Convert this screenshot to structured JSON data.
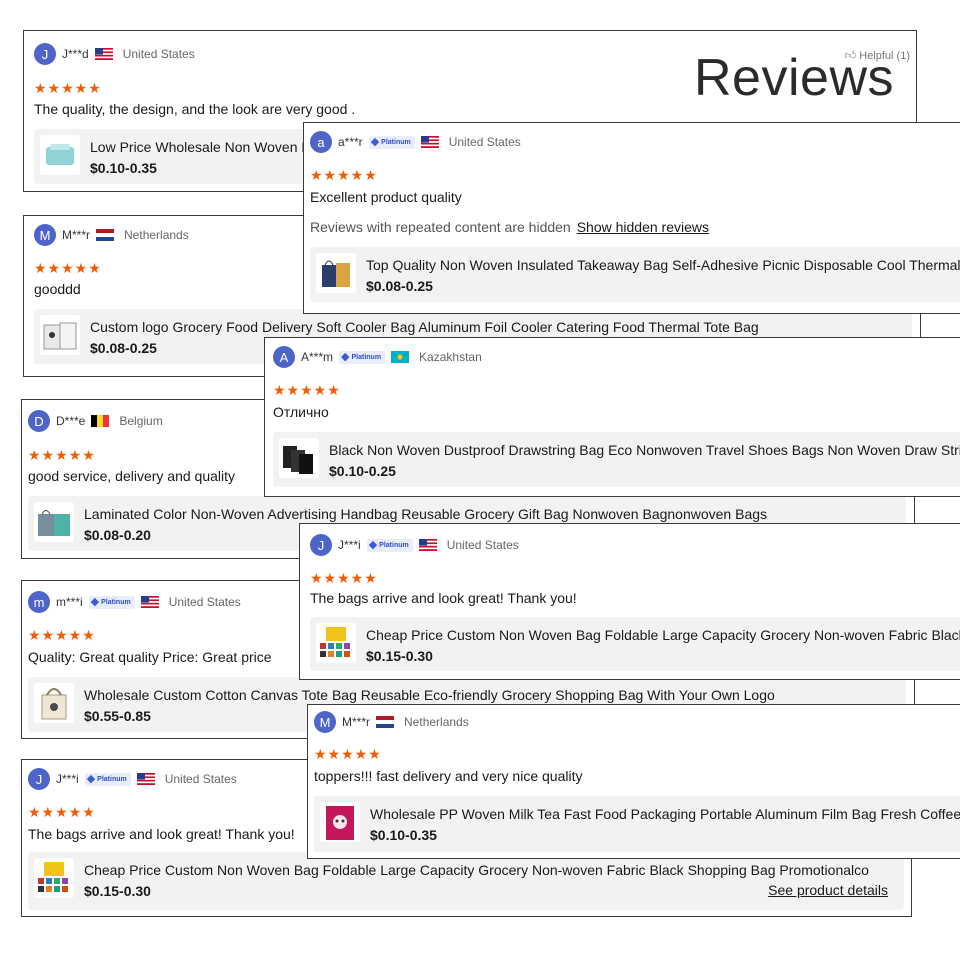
{
  "page_title": "Reviews",
  "helpful_label": "Helpful (1)",
  "hidden_note": "Reviews with repeated content are hidden",
  "show_hidden_label": "Show hidden reviews",
  "see_details_label": "See product details",
  "badge_label": "Platinum",
  "star_glyphs": "★★★★★",
  "colors": {
    "accent_star": "#f25c05",
    "avatar": "#4d64c9",
    "badge": "#2f4fc9"
  },
  "reviews": [
    {
      "initial": "J",
      "user": "J***d",
      "country": "United States",
      "text": "The quality, the design, and the look are very good .",
      "product": "Low Price Wholesale Non Woven Bag",
      "price": "$0.10-0.35"
    },
    {
      "initial": "a",
      "user": "a***r",
      "country": "United States",
      "text": "Excellent product quality",
      "product": "Top Quality Non Woven Insulated Takeaway Bag Self-Adhesive Picnic Disposable Cool Thermal Bag",
      "price": "$0.08-0.25"
    },
    {
      "initial": "M",
      "user": "M***r",
      "country": "Netherlands",
      "text": "gooddd",
      "product": "Custom logo Grocery Food Delivery Soft Cooler Bag Aluminum Foil Cooler Catering Food Thermal Tote Bag",
      "price": "$0.08-0.25"
    },
    {
      "initial": "A",
      "user": "A***m",
      "country": "Kazakhstan",
      "text": "Отлично",
      "product": "Black Non Woven Dustproof Drawstring Bag Eco Nonwoven Travel Shoes Bags Non Woven Draw String Bag",
      "price": "$0.10-0.25"
    },
    {
      "initial": "D",
      "user": "D***e",
      "country": "Belgium",
      "text": "good service, delivery and quality",
      "product": "Laminated Color Non-Woven Advertising Handbag Reusable Grocery Gift Bag Nonwoven Bagnonwoven Bags",
      "price": "$0.08-0.20"
    },
    {
      "initial": "J",
      "user": "J***i",
      "country": "United States",
      "text": "The bags arrive and look great! Thank you!",
      "product": "Cheap Price Custom Non Woven Bag Foldable Large Capacity Grocery Non-woven Fabric Black Shopping Bag",
      "price": "$0.15-0.30"
    },
    {
      "initial": "m",
      "user": "m***i",
      "country": "United States",
      "text": "Quality: Great quality Price: Great price",
      "product": "Wholesale Custom Cotton Canvas Tote Bag Reusable Eco-friendly Grocery Shopping Bag With Your Own Logo",
      "price": "$0.55-0.85"
    },
    {
      "initial": "M",
      "user": "M***r",
      "country": "Netherlands",
      "text": "toppers!!! fast delivery and very nice quality",
      "product": "Wholesale PP Woven Milk Tea Fast Food Packaging Portable Aluminum Film Bag Fresh Coffee Bag",
      "price": "$0.10-0.35"
    },
    {
      "initial": "J",
      "user": "J***i",
      "country": "United States",
      "text": "The bags arrive and look great! Thank you!",
      "product": "Cheap Price Custom Non Woven Bag Foldable Large Capacity Grocery Non-woven Fabric Black Shopping Bag Promotionalco",
      "price": "$0.15-0.30"
    }
  ]
}
